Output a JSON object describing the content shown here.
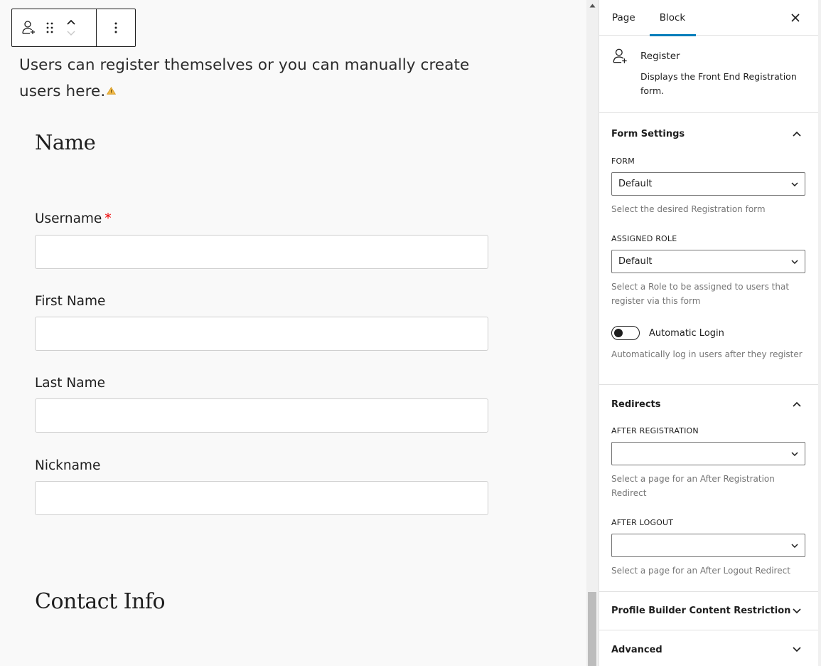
{
  "toolbar": {
    "block_type_icon": "user-plus-icon",
    "drag_icon": "drag-handle-icon",
    "move_up_icon": "chevron-up-icon",
    "move_down_icon": "chevron-down-icon",
    "options_icon": "more-vertical-icon"
  },
  "canvas": {
    "intro_text": "Users can register themselves or you can manually create users here.",
    "warning_icon": "warning-triangle-icon",
    "heading_name": "Name",
    "fields": [
      {
        "label": "Username",
        "required": true,
        "required_mark": "*",
        "value": ""
      },
      {
        "label": "First Name",
        "required": false,
        "value": ""
      },
      {
        "label": "Last Name",
        "required": false,
        "value": ""
      },
      {
        "label": "Nickname",
        "required": false,
        "value": ""
      }
    ],
    "heading_contact": "Contact Info"
  },
  "sidebar": {
    "tabs": [
      {
        "label": "Page",
        "active": false
      },
      {
        "label": "Block",
        "active": true
      }
    ],
    "close_icon": "close-icon",
    "block": {
      "icon": "user-plus-icon",
      "title": "Register",
      "description": "Displays the Front End Registration form."
    },
    "form_settings": {
      "title": "Form Settings",
      "expanded": true,
      "form_label": "FORM",
      "form_value": "Default",
      "form_help": "Select the desired Registration form",
      "role_label": "ASSIGNED ROLE",
      "role_value": "Default",
      "role_help": "Select a Role to be assigned to users that register via this form",
      "auto_login_label": "Automatic Login",
      "auto_login_enabled": false,
      "auto_login_help": "Automatically log in users after they register"
    },
    "redirects": {
      "title": "Redirects",
      "expanded": true,
      "after_registration_label": "AFTER REGISTRATION",
      "after_registration_value": "",
      "after_registration_help": "Select a page for an After Registration Redirect",
      "after_logout_label": "AFTER LOGOUT",
      "after_logout_value": "",
      "after_logout_help": "Select a page for an After Logout Redirect"
    },
    "content_restriction": {
      "title": "Profile Builder Content Restriction",
      "expanded": false
    },
    "advanced": {
      "title": "Advanced",
      "expanded": false
    }
  },
  "colors": {
    "accent": "#007cba",
    "required": "#e00000",
    "warning": "#f0b849"
  }
}
